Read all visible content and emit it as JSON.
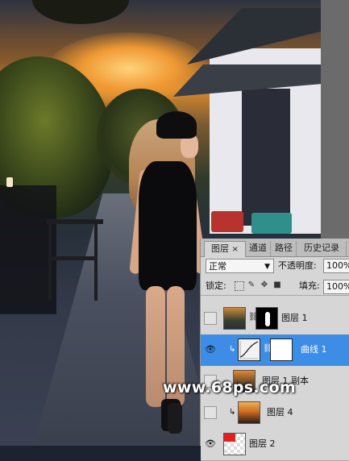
{
  "watermark": "www.68ps.com",
  "layers_panel": {
    "tabs": [
      "图层",
      "通道",
      "路径",
      "历史记录"
    ],
    "active_tab_close": "×",
    "blend_mode": "正常",
    "opacity_label": "不透明度:",
    "opacity_value": "100%",
    "lock_label": "锁定:",
    "fill_label": "填充:",
    "fill_value": "100%",
    "layers": [
      {
        "name": "图层 1",
        "visible": false,
        "selected": false,
        "has_mask": true,
        "clipped": false
      },
      {
        "name": "曲线 1",
        "visible": true,
        "selected": true,
        "has_mask": true,
        "clipped": true
      },
      {
        "name": "图层 1 副本",
        "visible": false,
        "selected": false,
        "has_mask": false,
        "clipped": false
      },
      {
        "name": "图层 4",
        "visible": false,
        "selected": false,
        "has_mask": false,
        "clipped": true
      },
      {
        "name": "图层 2",
        "visible": true,
        "selected": false,
        "has_mask": false,
        "clipped": false
      }
    ]
  },
  "colors": {
    "selection": "#3d8de6",
    "panel_bg": "#d6d6d6"
  }
}
